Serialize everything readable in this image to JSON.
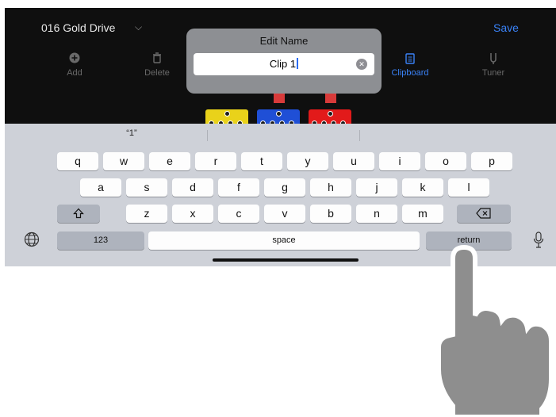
{
  "header": {
    "preset_name": "016 Gold Drive",
    "save_label": "Save"
  },
  "toolbar": {
    "items": [
      {
        "label": "Add",
        "icon": "plus-circle-icon"
      },
      {
        "label": "Delete",
        "icon": "trash-icon"
      },
      {
        "label": "Clipboard",
        "icon": "clipboard-icon"
      },
      {
        "label": "Tuner",
        "icon": "tuner-icon"
      }
    ]
  },
  "dialog": {
    "title": "Edit Name",
    "value": "Clip 1"
  },
  "keyboard": {
    "suggestion": "“1”",
    "row1": [
      "q",
      "w",
      "e",
      "r",
      "t",
      "y",
      "u",
      "i",
      "o",
      "p"
    ],
    "row2": [
      "a",
      "s",
      "d",
      "f",
      "g",
      "h",
      "j",
      "k",
      "l"
    ],
    "row3": [
      "z",
      "x",
      "c",
      "v",
      "b",
      "n",
      "m"
    ],
    "numbers_label": "123",
    "space_label": "space",
    "return_label": "return"
  },
  "colors": {
    "accent": "#3a82f7",
    "pedal_yellow": "#e9d21a",
    "pedal_blue": "#1f4fd6",
    "pedal_red": "#e21a1a"
  }
}
